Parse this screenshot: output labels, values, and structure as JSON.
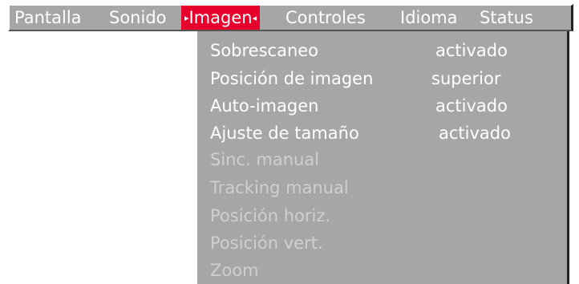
{
  "menubar": {
    "items": [
      {
        "label": "Pantalla"
      },
      {
        "label": "Sonido"
      },
      {
        "label": "Imagen",
        "arrow_left": "▸",
        "arrow_right": "◂"
      },
      {
        "label": "Controles"
      },
      {
        "label": "Idioma"
      },
      {
        "label": "Status"
      }
    ],
    "active_color": "#e8002d",
    "bg_color": "#a6a6a6"
  },
  "dropdown": {
    "items": [
      {
        "label": "Sobrescaneo",
        "value": "activado",
        "enabled": true
      },
      {
        "label": "Posición de imagen",
        "value": "superior",
        "enabled": true
      },
      {
        "label": "Auto-imagen",
        "value": "activado",
        "enabled": true
      },
      {
        "label": "Ajuste de tamaño",
        "value": "activado",
        "enabled": true
      },
      {
        "label": "Sinc. manual",
        "enabled": false
      },
      {
        "label": "Tracking manual",
        "enabled": false
      },
      {
        "label": "Posición horiz.",
        "enabled": false
      },
      {
        "label": "Posición vert.",
        "enabled": false
      },
      {
        "label": "Zoom",
        "enabled": false
      }
    ]
  }
}
